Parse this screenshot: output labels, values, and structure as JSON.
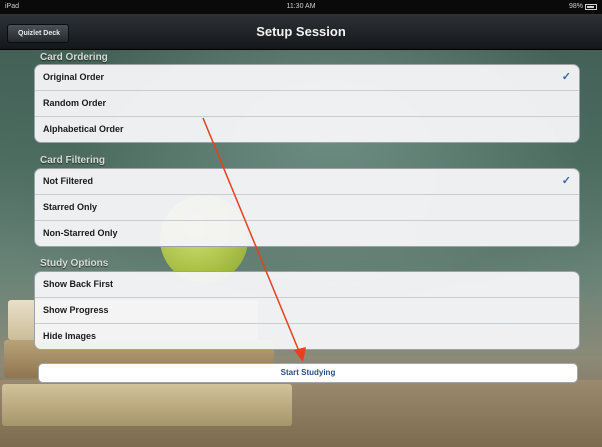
{
  "status_bar": {
    "carrier": "iPad",
    "time": "11:30 AM",
    "battery": "98%"
  },
  "nav": {
    "back_label": "Quizlet Deck",
    "title": "Setup Session"
  },
  "sections": [
    {
      "header": "Card Ordering",
      "rows": [
        {
          "label": "Original Order",
          "checked": true
        },
        {
          "label": "Random Order",
          "checked": false
        },
        {
          "label": "Alphabetical Order",
          "checked": false
        }
      ]
    },
    {
      "header": "Card Filtering",
      "rows": [
        {
          "label": "Not Filtered",
          "checked": true
        },
        {
          "label": "Starred Only",
          "checked": false
        },
        {
          "label": "Non-Starred Only",
          "checked": false
        }
      ]
    },
    {
      "header": "Study Options",
      "rows": [
        {
          "label": "Show Back First",
          "checked": false
        },
        {
          "label": "Show Progress",
          "checked": false
        },
        {
          "label": "Hide Images",
          "checked": false
        }
      ]
    }
  ],
  "check_glyph": "✓",
  "start_button_label": "Start Studying",
  "colors": {
    "accent": "#3b67a6",
    "annotation_arrow": "#e8401c"
  }
}
